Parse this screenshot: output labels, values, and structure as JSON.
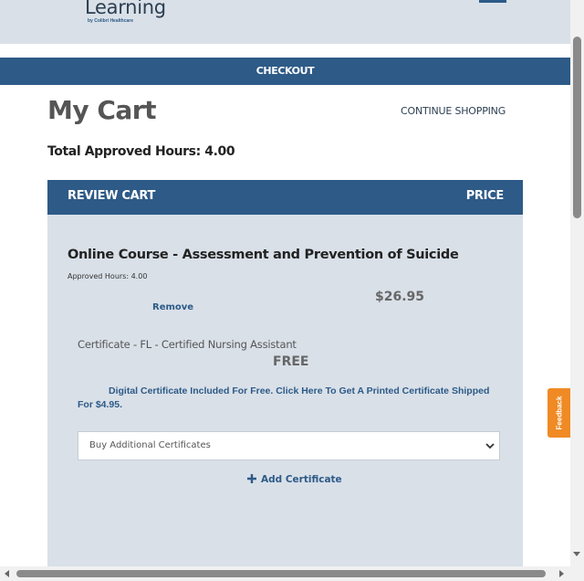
{
  "header": {
    "logo_text": "Learning",
    "logo_subtext": "by Colibri Healthcare"
  },
  "checkout_bar": {
    "label": "CHECKOUT"
  },
  "cart": {
    "title": "My Cart",
    "continue_shopping": "CONTINUE SHOPPING",
    "total_hours": "Total Approved Hours: 4.00",
    "table_header": {
      "review": "REVIEW CART",
      "price": "PRICE"
    },
    "item": {
      "title": "Online Course - Assessment and Prevention of Suicide",
      "approved_hours": "Approved Hours: 4.00",
      "price": "$26.95",
      "remove_label": "Remove"
    },
    "certificate": {
      "name": "Certificate - FL - Certified Nursing Assistant",
      "price": "FREE",
      "digital_note": "Digital Certificate Included For Free. Click Here To Get A Printed Certificate Shipped For $4.95."
    },
    "additional_select": {
      "selected": "Buy Additional Certificates"
    },
    "add_certificate_label": "Add Certificate"
  },
  "feedback_tab": {
    "label": "Feedback"
  },
  "colors": {
    "primary_blue": "#2d5a87",
    "panel_gray": "#d9e0e8",
    "feedback_orange": "#f08a24"
  }
}
